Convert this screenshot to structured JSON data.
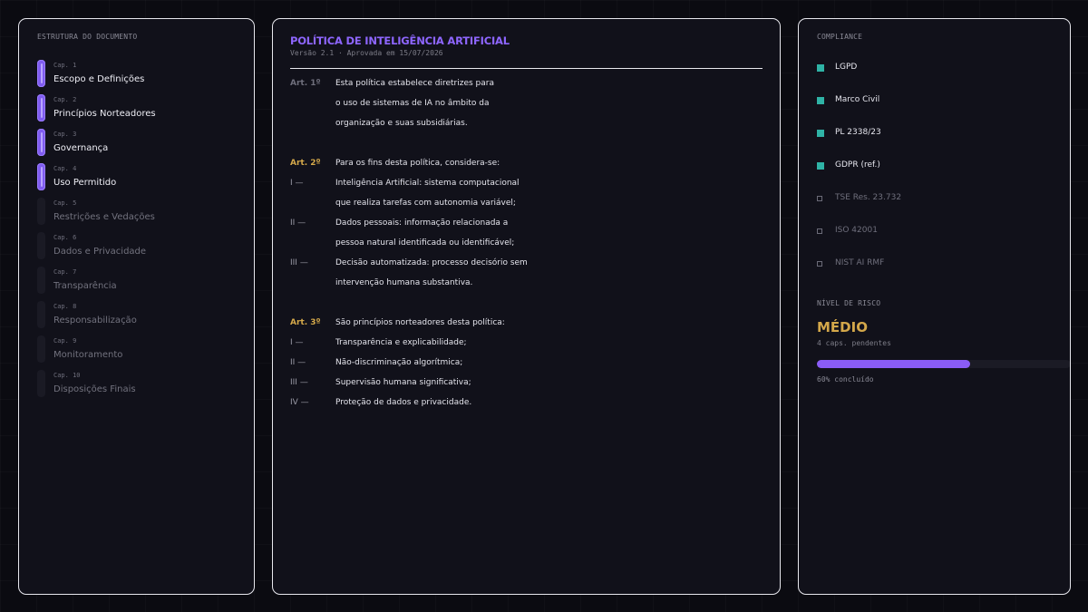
{
  "structure": {
    "title": "ESTRUTURA DO DOCUMENTO",
    "items": [
      {
        "cap": "Cap. 1",
        "label": "Escopo e Definições",
        "active": true
      },
      {
        "cap": "Cap. 2",
        "label": "Princípios Norteadores",
        "active": true
      },
      {
        "cap": "Cap. 3",
        "label": "Governança",
        "active": true
      },
      {
        "cap": "Cap. 4",
        "label": "Uso Permitido",
        "active": true
      },
      {
        "cap": "Cap. 5",
        "label": "Restrições e Vedações",
        "active": false
      },
      {
        "cap": "Cap. 6",
        "label": "Dados e Privacidade",
        "active": false
      },
      {
        "cap": "Cap. 7",
        "label": "Transparência",
        "active": false
      },
      {
        "cap": "Cap. 8",
        "label": "Responsabilização",
        "active": false
      },
      {
        "cap": "Cap. 9",
        "label": "Monitoramento",
        "active": false
      },
      {
        "cap": "Cap. 10",
        "label": "Disposições Finais",
        "active": false
      }
    ]
  },
  "document": {
    "title": "POLÍTICA DE INTELIGÊNCIA ARTIFICIAL",
    "version": "Versão 2.1 · Aprovada em 15/07/2026",
    "articles": [
      {
        "label": "Art. 1º",
        "lines": [
          "Esta política estabelece diretrizes para",
          "o uso de sistemas de IA no âmbito da",
          "organização e suas subsidiárias."
        ]
      },
      {
        "label": "Art. 2º",
        "lines": [
          "Para os fins desta política, considera-se:"
        ],
        "items": [
          {
            "num": "I —",
            "lines": [
              "Inteligência Artificial: sistema computacional",
              "que realiza tarefas com autonomia variável;"
            ]
          },
          {
            "num": "II —",
            "lines": [
              "Dados pessoais: informação relacionada a",
              "pessoa natural identificada ou identificável;"
            ]
          },
          {
            "num": "III —",
            "lines": [
              "Decisão automatizada: processo decisório sem",
              "intervenção humana substantiva."
            ]
          }
        ]
      },
      {
        "label": "Art. 3º",
        "lines": [
          "São princípios norteadores desta política:"
        ],
        "items": [
          {
            "num": "I —",
            "lines": [
              "Transparência e explicabilidade;"
            ]
          },
          {
            "num": "II —",
            "lines": [
              "Não-discriminação algorítmica;"
            ]
          },
          {
            "num": "III —",
            "lines": [
              "Supervisão humana significativa;"
            ]
          },
          {
            "num": "IV —",
            "lines": [
              "Proteção de dados e privacidade."
            ]
          }
        ]
      }
    ]
  },
  "compliance": {
    "title": "COMPLIANCE",
    "items": [
      {
        "label": "LGPD",
        "checked": true
      },
      {
        "label": "Marco Civil",
        "checked": true
      },
      {
        "label": "PL 2338/23",
        "checked": true
      },
      {
        "label": "GDPR (ref.)",
        "checked": true
      },
      {
        "label": "TSE Res. 23.732",
        "checked": false
      },
      {
        "label": "ISO 42001",
        "checked": false
      },
      {
        "label": "NIST AI RMF",
        "checked": false
      }
    ]
  },
  "risk": {
    "title": "NÍVEL DE RISCO",
    "level": "MÉDIO",
    "pending": "4 caps. pendentes",
    "progress": 0.6,
    "progress_text": "60% concluído"
  },
  "colors": {
    "accent": "#8e66ff",
    "gold": "#d4a84a",
    "teal": "#2fb3a6"
  }
}
